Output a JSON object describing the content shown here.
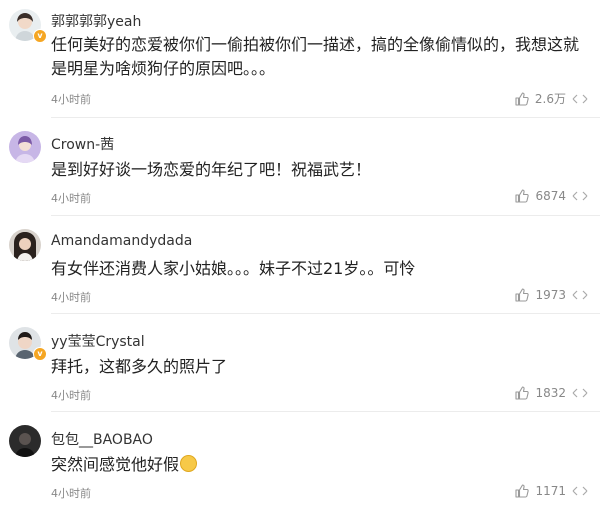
{
  "comments": [
    {
      "username": "郭郭郭郭yeah",
      "text": "任何美好的恋爱被你们一偷拍被你们一描述，搞的全像偷情似的，我想这就是明星为啥烦狗仔的原因吧。。。",
      "time": "4小时前",
      "likes": "2.6万",
      "avatar_icon": "avatar-girl-icon",
      "verified": true
    },
    {
      "username": "Crown-茜",
      "text": "是到好好谈一场恋爱的年纪了吧！祝福武艺！",
      "time": "4小时前",
      "likes": "6874",
      "avatar_icon": "avatar-purple-icon",
      "verified": false
    },
    {
      "username": "Amandamandydada",
      "text": "有女伴还消费人家小姑娘。。。妹子不过21岁。。可怜",
      "time": "4小时前",
      "likes": "1973",
      "avatar_icon": "avatar-woman-icon",
      "verified": false
    },
    {
      "username": "yy莹莹Crystal",
      "text": "拜托，这都多久的照片了",
      "time": "4小时前",
      "likes": "1832",
      "avatar_icon": "avatar-man-icon",
      "verified": true
    },
    {
      "username": "包包__BAOBAO",
      "text": "突然间感觉他好假",
      "time": "4小时前",
      "likes": "1171",
      "avatar_icon": "avatar-dark-icon",
      "verified": false,
      "emoji": "smile-emoji-icon"
    }
  ],
  "colors": {
    "text": "#222222",
    "meta": "#888888",
    "verified_badge": "#f5a623",
    "divider": "#ececec"
  }
}
